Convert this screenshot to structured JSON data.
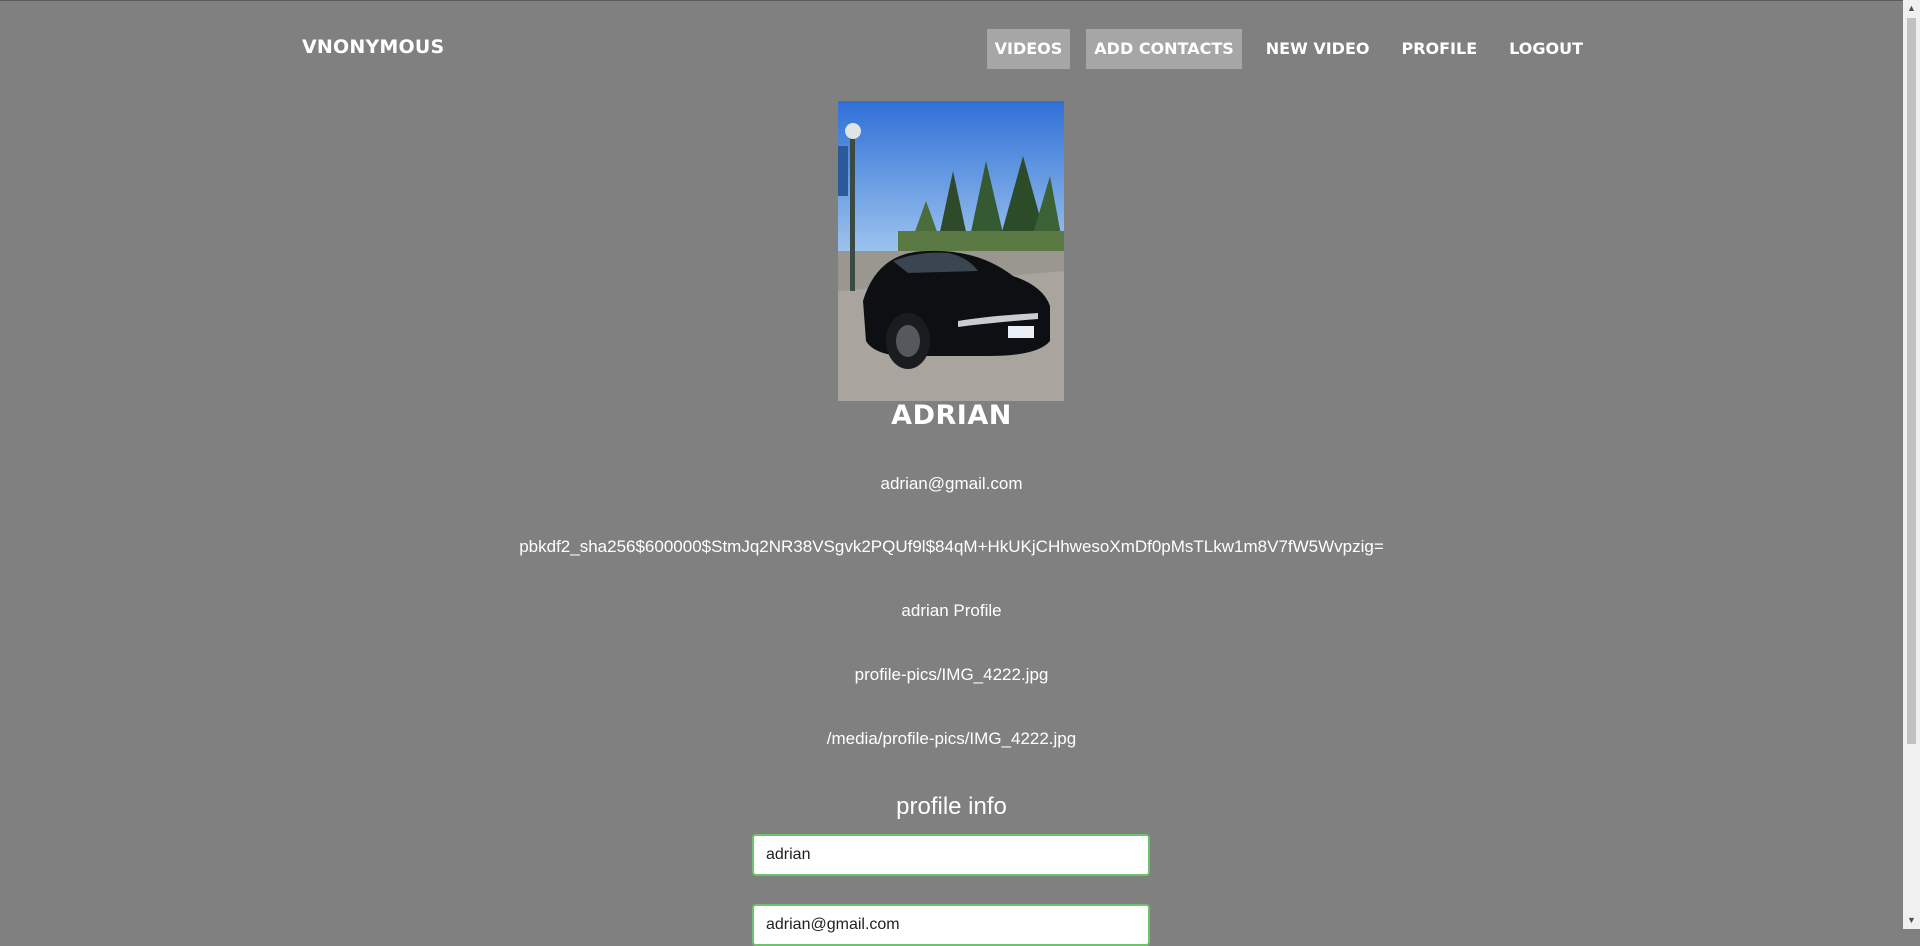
{
  "brand": "VNONYMOUS",
  "nav": {
    "items": [
      {
        "label": "VIDEOS",
        "active": true
      },
      {
        "label": "ADD CONTACTS",
        "active": true
      },
      {
        "label": "NEW VIDEO",
        "active": false
      },
      {
        "label": "PROFILE",
        "active": false
      },
      {
        "label": "LOGOUT",
        "active": false
      }
    ]
  },
  "profile": {
    "name": "ADRIAN",
    "email": "adrian@gmail.com",
    "password_hash": "pbkdf2_sha256$600000$StmJq2NR38VSgvk2PQUf9l$84qM+HkUKjCHhwesoXmDf0pMsTLkw1m8V7fW5Wvpzig=",
    "bio": "adrian Profile",
    "pic_name": "profile-pics/IMG_4222.jpg",
    "pic_url": "/media/profile-pics/IMG_4222.jpg"
  },
  "form": {
    "title": "profile info",
    "username_value": "adrian",
    "email_value": "adrian@gmail.com"
  },
  "colors": {
    "background": "#808080",
    "nav_active": "#a6a6a6",
    "field_border": "#6cc36c"
  }
}
